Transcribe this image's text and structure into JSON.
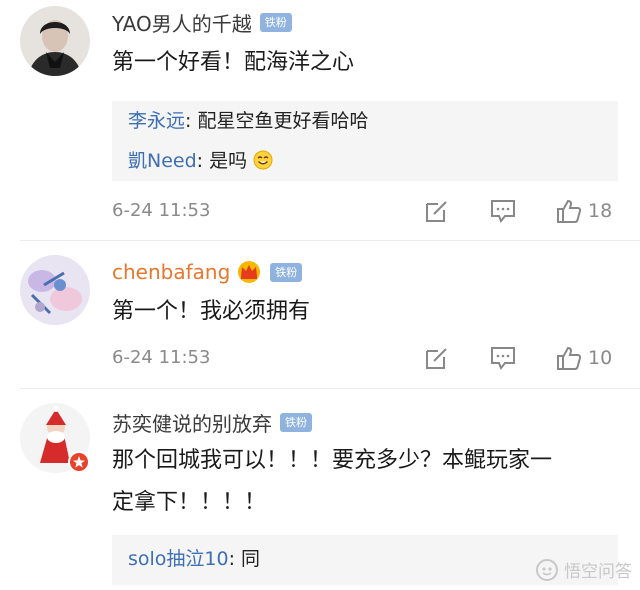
{
  "comments": [
    {
      "username": "YAO男人的千越",
      "badge": "铁粉",
      "content": "第一个好看！配海洋之心",
      "replies": [
        {
          "name": "李永远",
          "text": ": 配星空鱼更好看哈哈"
        },
        {
          "name": "凱Need",
          "text": ": 是吗",
          "emoji": "smile"
        }
      ],
      "time": "6-24 11:53",
      "likes": "18"
    },
    {
      "username": "chenbafang",
      "badge": "铁粉",
      "content": "第一个！我必须拥有",
      "time": "6-24 11:53",
      "likes": "10"
    },
    {
      "username": "苏奕健说的别放弃",
      "badge": "铁粉",
      "content_line1": "那个回城我可以！！！要充多少？本鲲玩家一",
      "content_line2": "定拿下！！！！",
      "replies": [
        {
          "name": "solo抽泣10",
          "text": ": 同"
        }
      ]
    }
  ],
  "watermark": "悟空问答",
  "colors": {
    "reply_name": "#3e6fb4",
    "badge": "#8fb3de",
    "vip_name": "#e8772e"
  }
}
